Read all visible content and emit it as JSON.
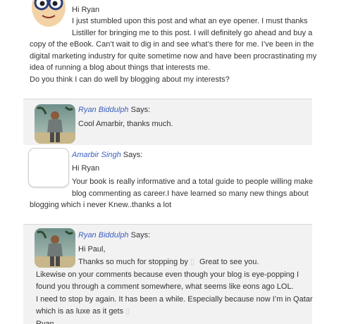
{
  "comments": [
    {
      "lines": [
        "Hi Ryan",
        "I just stumbled upon this post and what an eye opener. I must thanks",
        "Listiller for bringing me to this post. I will definitely go ahead and buy a",
        "copy of the eBook. Can’t wait to dig in and see what’s there for me. I’ve been in the",
        "digital marketing industry for quite sometime now and have been procrastinating my",
        "idea of running a blog about things that interests me.",
        "Do you think I can do well by blogging about my interests?"
      ]
    },
    {
      "author": "Ryan Biddulph",
      "says": "Says:",
      "lines": [
        "Cool Amarbir, thanks much."
      ]
    },
    {
      "author": "Amarbir Singh",
      "says": "Says:",
      "lines": [
        "Hi Ryan",
        "Your book is really informative and a total guide to people willing make",
        "blog commenting as career.I have learned so many new things about",
        "blogging which i never Knew..thanks a lot"
      ]
    },
    {
      "author": "Ryan Biddulph",
      "says": "Says:",
      "lines": [
        "Hi Paul,",
        "Thanks so much for stopping by",
        "Great to see you.",
        "Likewise on your comments because even though your blog is eye-popping I",
        "found you through a comment somewhere, what seems like eons ago LOL.",
        "I need to stop by again. It has been a while. Especially because now I’m in Qatar",
        "which is as luxe as it gets",
        "Ryan"
      ]
    }
  ]
}
